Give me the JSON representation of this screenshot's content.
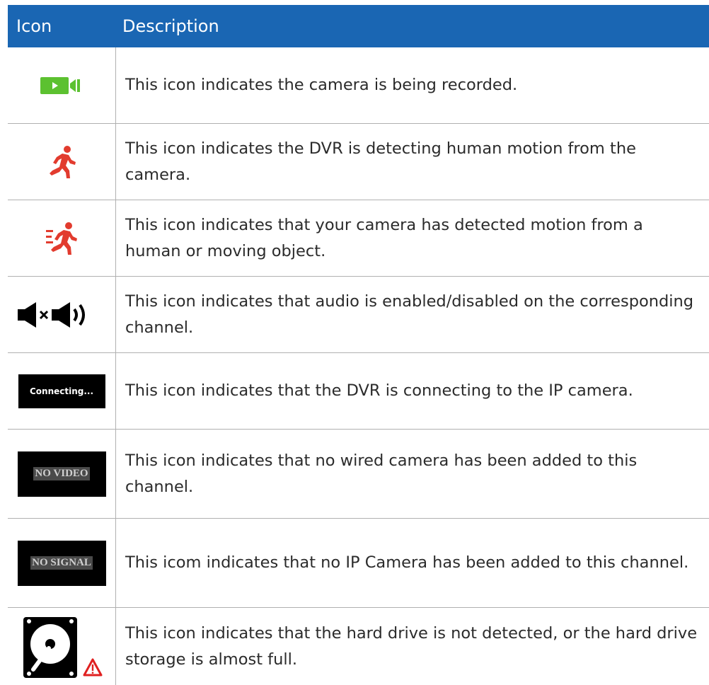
{
  "header": {
    "icon_col": "Icon",
    "desc_col": "Description"
  },
  "rows": [
    {
      "icon": "record-camera-icon",
      "icon_color": "#5cc130",
      "description": "This icon indicates the camera is being recorded."
    },
    {
      "icon": "human-motion-icon",
      "icon_color": "#e23b2e",
      "description": "This icon indicates the DVR is detecting human motion from the camera."
    },
    {
      "icon": "motion-detected-icon",
      "icon_color": "#e23b2e",
      "description": "This icon indicates that your camera has detected motion from a human or moving object."
    },
    {
      "icon": "audio-toggle-icon",
      "icon_color": "#000000",
      "description": "This icon indicates that audio is enabled/disabled on the corresponding channel."
    },
    {
      "icon": "connecting-icon",
      "icon_label": "Connecting...",
      "description": "This icon indicates that the DVR is connecting to the IP camera."
    },
    {
      "icon": "no-video-icon",
      "icon_label": "NO VIDEO",
      "description": "This icon indicates that no wired camera has been added to this channel."
    },
    {
      "icon": "no-signal-icon",
      "icon_label": "NO SIGNAL",
      "description": "This icom indicates that no IP Camera has been added to this channel."
    },
    {
      "icon": "hard-drive-warning-icon",
      "icon_color": "#000000",
      "description": "This icon indicates that the hard drive is not detected, or the hard drive storage is almost full."
    }
  ]
}
